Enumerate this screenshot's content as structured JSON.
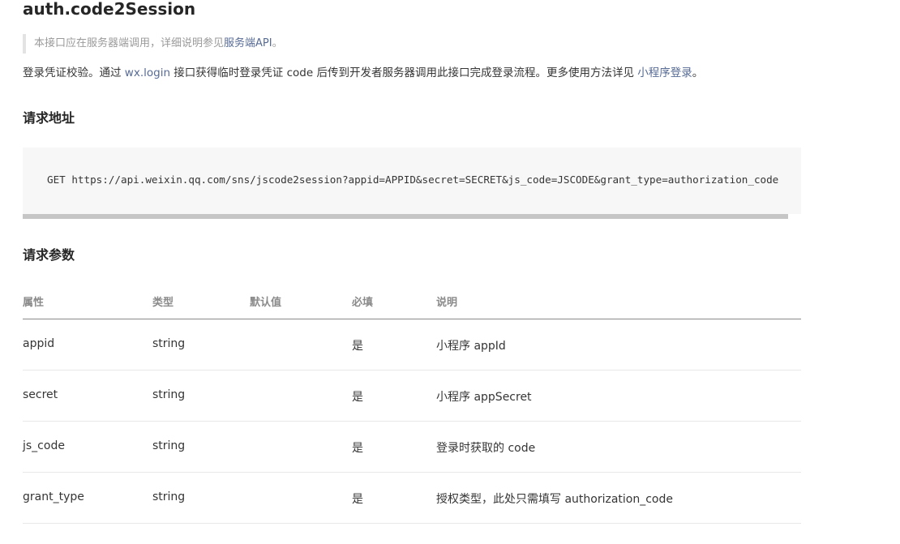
{
  "title": "auth.code2Session",
  "note": {
    "text": "本接口应在服务器端调用，详细说明参见",
    "link": "服务端API",
    "suffix": "。"
  },
  "description": {
    "part1": "登录凭证校验。通过 ",
    "link1": "wx.login",
    "part2": " 接口获得临时登录凭证 code 后传到开发者服务器调用此接口完成登录流程。更多使用方法详见 ",
    "link2": "小程序登录",
    "part3": "。"
  },
  "request_url": {
    "heading": "请求地址",
    "code": "GET https://api.weixin.qq.com/sns/jscode2session?appid=APPID&secret=SECRET&js_code=JSCODE&grant_type=authorization_code"
  },
  "request_params": {
    "heading": "请求参数",
    "columns": [
      "属性",
      "类型",
      "默认值",
      "必填",
      "说明"
    ],
    "rows": [
      {
        "name": "appid",
        "type": "string",
        "default": "",
        "required": "是",
        "desc": "小程序 appId"
      },
      {
        "name": "secret",
        "type": "string",
        "default": "",
        "required": "是",
        "desc": "小程序 appSecret"
      },
      {
        "name": "js_code",
        "type": "string",
        "default": "",
        "required": "是",
        "desc": "登录时获取的 code"
      },
      {
        "name": "grant_type",
        "type": "string",
        "default": "",
        "required": "是",
        "desc": "授权类型，此处只需填写 authorization_code"
      }
    ]
  },
  "colors": {
    "link": "#576b95",
    "note_border": "#e3e3e3",
    "code_bg": "#f7f7f7"
  }
}
